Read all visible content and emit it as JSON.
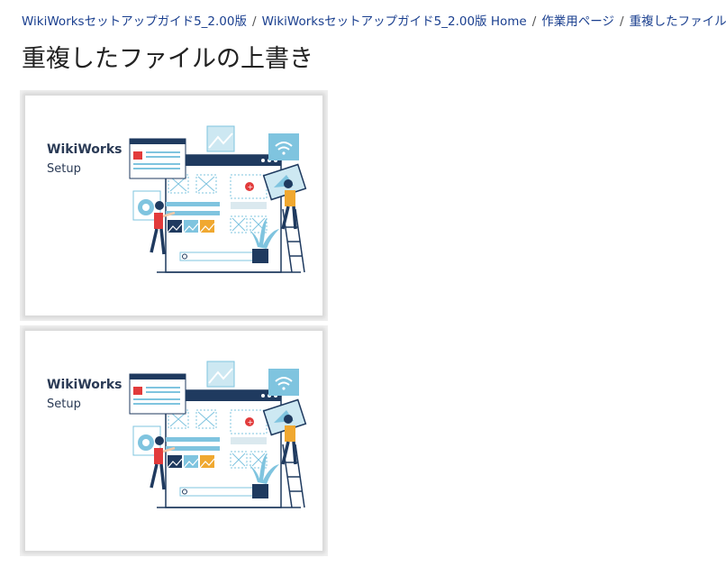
{
  "breadcrumb": {
    "items": [
      {
        "label": "WikiWorksセットアップガイド5_2.00版"
      },
      {
        "label": "WikiWorksセットアップガイド5_2.00版 Home"
      },
      {
        "label": "作業用ページ"
      },
      {
        "label": "重複したファイルの上書き"
      }
    ],
    "separator": "/"
  },
  "page": {
    "title": "重複したファイルの上書き"
  },
  "images": [
    {
      "line1": "WikiWorks",
      "line2": "Setup"
    },
    {
      "line1": "WikiWorks",
      "line2": "Setup"
    }
  ],
  "colors": {
    "link": "#1a3f8f",
    "navy": "#1f3a5f",
    "lightblue": "#7fc4df",
    "accent_red": "#e23b3b",
    "accent_yellow": "#f0a830"
  }
}
